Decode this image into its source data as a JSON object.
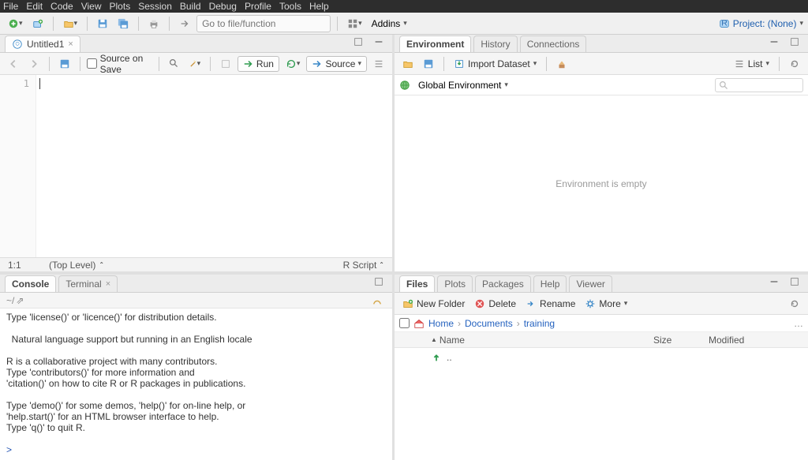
{
  "menu": {
    "items": [
      "File",
      "Edit",
      "Code",
      "View",
      "Plots",
      "Session",
      "Build",
      "Debug",
      "Profile",
      "Tools",
      "Help"
    ]
  },
  "toolbar": {
    "goto_placeholder": "Go to file/function",
    "addins_label": "Addins",
    "project_label": "Project: (None)"
  },
  "source": {
    "tab": {
      "filename": "Untitled1"
    },
    "toolbar": {
      "source_on_save": "Source on Save",
      "run": "Run",
      "source": "Source"
    },
    "status": {
      "pos": "1:1",
      "scope": "(Top Level)",
      "type": "R Script"
    },
    "gutter": "1"
  },
  "console": {
    "tabs": {
      "console": "Console",
      "terminal": "Terminal"
    },
    "subpath": "~/",
    "text": "Type 'license()' or 'licence()' for distribution details.\n\n  Natural language support but running in an English locale\n\nR is a collaborative project with many contributors.\nType 'contributors()' for more information and\n'citation()' on how to cite R or R packages in publications.\n\nType 'demo()' for some demos, 'help()' for on-line help, or\n'help.start()' for an HTML browser interface to help.\nType 'q()' to quit R.\n",
    "prompt": ">"
  },
  "env": {
    "tabs": {
      "env": "Environment",
      "hist": "History",
      "conn": "Connections"
    },
    "import": "Import Dataset",
    "list": "List",
    "scope": "Global Environment",
    "search_placeholder": "",
    "empty": "Environment is empty"
  },
  "files": {
    "tabs": {
      "files": "Files",
      "plots": "Plots",
      "packages": "Packages",
      "help": "Help",
      "viewer": "Viewer"
    },
    "toolbar": {
      "new_folder": "New Folder",
      "delete": "Delete",
      "rename": "Rename",
      "more": "More"
    },
    "breadcrumb": [
      "Home",
      "Documents",
      "training"
    ],
    "header": {
      "name": "Name",
      "size": "Size",
      "modified": "Modified"
    },
    "up": ".."
  }
}
